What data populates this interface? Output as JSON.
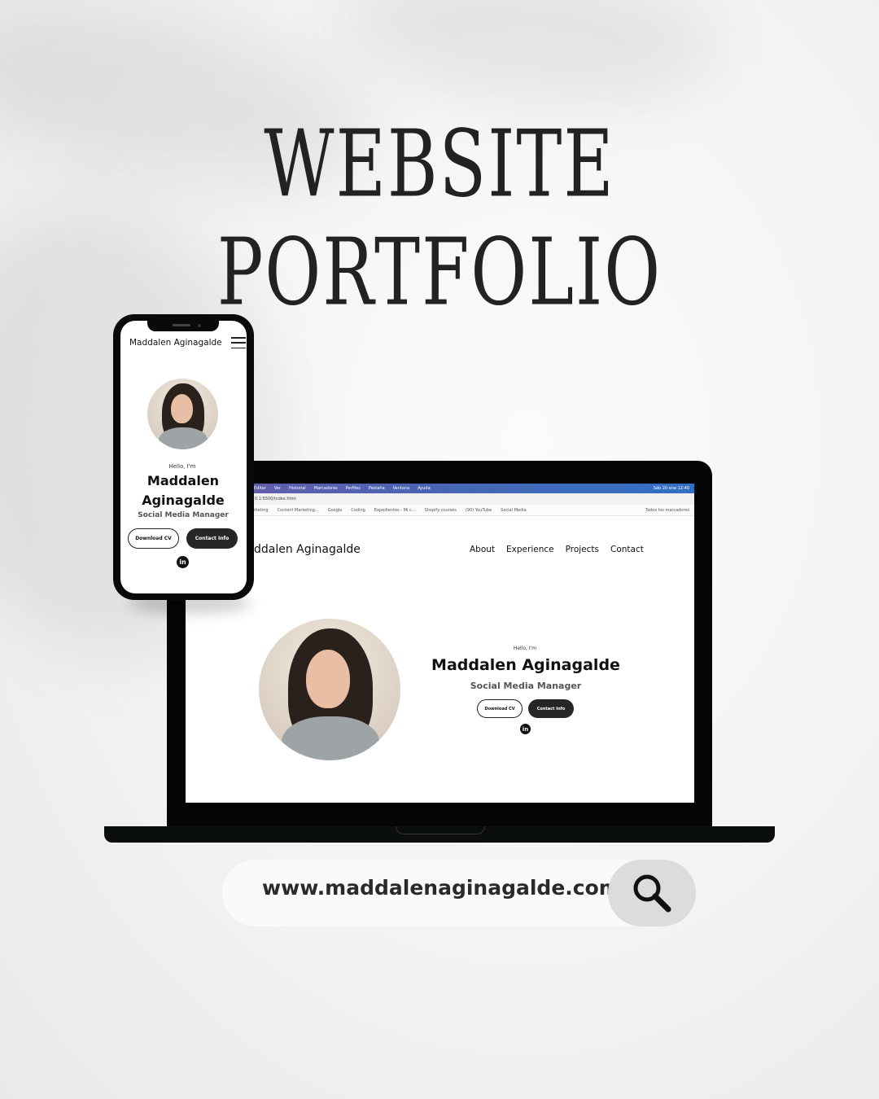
{
  "headline": {
    "line1": "WEBSITE",
    "line2": "PORTFOLIO"
  },
  "laptop": {
    "menubar": {
      "items": [
        "Editar",
        "Ver",
        "Historial",
        "Marcadores",
        "Perfiles",
        "Pestaña",
        "Ventana",
        "Ayuda"
      ],
      "status": "Sáb 20 ene  12:40"
    },
    "url": "0.1:5500/index.html",
    "bookmarks": [
      "rketing",
      "Content Marketing...",
      "Google",
      "Coding",
      "Expedientes - Mi c...",
      "Shopify courses",
      "(90) YouTube",
      "Social Media",
      "Todos los marcadores"
    ],
    "site": {
      "brand": "ddalen Aginagalde",
      "nav": [
        "About",
        "Experience",
        "Projects",
        "Contact"
      ],
      "hello": "Hello, I'm",
      "name": "Maddalen Aginagalde",
      "role": "Social Media Manager",
      "download_label": "Download CV",
      "contact_label": "Contact Info",
      "linkedin": "in"
    }
  },
  "phone": {
    "brand": "Maddalen Aginagalde",
    "hello": "Hello, I'm",
    "name_line1": "Maddalen",
    "name_line2": "Aginagalde",
    "role": "Social Media Manager",
    "download_label": "Download CV",
    "contact_label": "Contact Info",
    "linkedin": "in"
  },
  "search": {
    "url": "www.maddalenaginagalde.com",
    "icon": "magnifier-icon"
  }
}
